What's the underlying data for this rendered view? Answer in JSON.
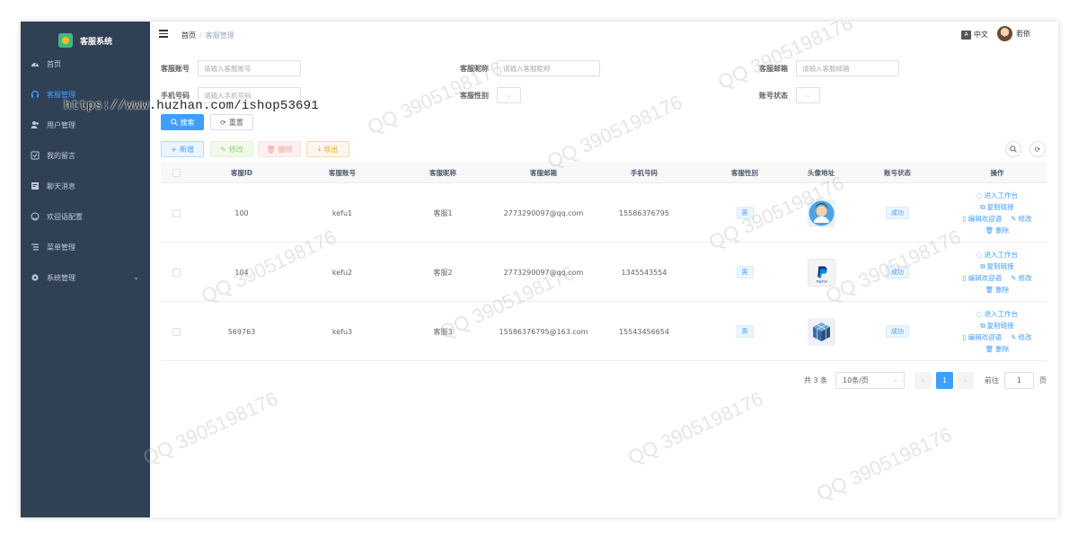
{
  "app": {
    "title": "客服系统"
  },
  "sidebar": {
    "items": [
      {
        "label": "首页",
        "icon": "dashboard-icon",
        "active": false
      },
      {
        "label": "客服管理",
        "icon": "headset-icon",
        "active": true
      },
      {
        "label": "用户管理",
        "icon": "user-icon",
        "active": false
      },
      {
        "label": "我的留言",
        "icon": "message-icon",
        "active": false
      },
      {
        "label": "聊天消息",
        "icon": "chat-icon",
        "active": false
      },
      {
        "label": "欢迎语配置",
        "icon": "smile-icon",
        "active": false
      },
      {
        "label": "菜单管理",
        "icon": "menu-list-icon",
        "active": false
      },
      {
        "label": "系统管理",
        "icon": "gear-icon",
        "active": false
      }
    ]
  },
  "header": {
    "breadcrumb": [
      "首页",
      "客服管理"
    ],
    "lang": "中文",
    "lang_badge": "A",
    "user": "若依"
  },
  "search": {
    "account_label": "客服账号",
    "account_placeholder": "请输入客服账号",
    "nickname_label": "客服昵称",
    "nickname_placeholder": "请输入客服昵称",
    "email_label": "客服邮箱",
    "email_placeholder": "请输入客服邮箱",
    "phone_label": "手机号码",
    "phone_placeholder": "请输入手机号码",
    "gender_label": "客服性别",
    "status_label": "账号状态",
    "search_btn": "搜索",
    "reset_btn": "重置"
  },
  "toolbar": {
    "add": "新增",
    "edit": "修改",
    "delete": "删除",
    "export": "导出"
  },
  "table": {
    "headers": [
      "客服ID",
      "客服账号",
      "客服昵称",
      "客服邮箱",
      "手机号码",
      "客服性别",
      "头像地址",
      "账号状态",
      "操作"
    ],
    "rows": [
      {
        "id": "100",
        "account": "kefu1",
        "nickname": "客服1",
        "email": "2773290097@qq.com",
        "phone": "15586376795",
        "gender": "男",
        "status": "成功",
        "avatar": "person-avatar-icon"
      },
      {
        "id": "104",
        "account": "kefu2",
        "nickname": "客服2",
        "email": "2773290097@qq.com",
        "phone": "1345543554",
        "gender": "男",
        "status": "成功",
        "avatar": "paypal-logo-icon"
      },
      {
        "id": "569763",
        "account": "kefu3",
        "nickname": "客服3",
        "email": "15586376795@163.com",
        "phone": "15543456654",
        "gender": "男",
        "status": "成功",
        "avatar": "cube-logo-icon"
      }
    ],
    "ops": {
      "enter": "进入工作台",
      "copy": "复制链接",
      "welcome": "编辑欢迎语",
      "edit": "修改",
      "delete": "删除"
    }
  },
  "pagination": {
    "total": "共 3 条",
    "page_size": "10条/页",
    "current": "1",
    "goto_label": "前往",
    "goto_value": "1",
    "page_suffix": "页"
  },
  "overlay": {
    "url": "https://www.huzhan.com/ishop53691",
    "watermark": "QQ 3905198176"
  },
  "colors": {
    "sidebar_bg": "#304156",
    "primary": "#409eff",
    "text": "#606266"
  }
}
